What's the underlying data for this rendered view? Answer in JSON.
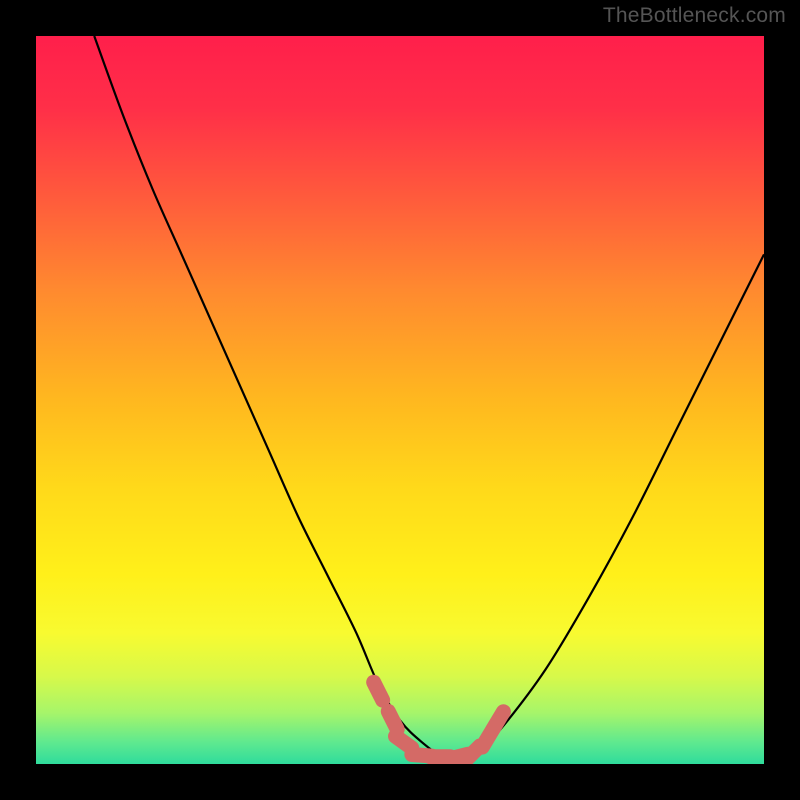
{
  "watermark": "TheBottleneck.com",
  "colors": {
    "bg": "#000000",
    "gradient_stops": [
      {
        "offset": 0.0,
        "color": "#ff1f4b"
      },
      {
        "offset": 0.1,
        "color": "#ff2f48"
      },
      {
        "offset": 0.22,
        "color": "#ff5a3c"
      },
      {
        "offset": 0.35,
        "color": "#ff8a2f"
      },
      {
        "offset": 0.5,
        "color": "#ffb81f"
      },
      {
        "offset": 0.62,
        "color": "#ffd91a"
      },
      {
        "offset": 0.74,
        "color": "#fff01a"
      },
      {
        "offset": 0.82,
        "color": "#f8fa30"
      },
      {
        "offset": 0.88,
        "color": "#d7f94a"
      },
      {
        "offset": 0.93,
        "color": "#a6f56a"
      },
      {
        "offset": 0.97,
        "color": "#5fe98f"
      },
      {
        "offset": 1.0,
        "color": "#2fdc9c"
      }
    ],
    "curve": "#000000",
    "marker_fill": "#d46a66",
    "marker_stroke": "#c45a58"
  },
  "chart_data": {
    "type": "line",
    "title": "",
    "xlabel": "",
    "ylabel": "",
    "xlim": [
      0,
      100
    ],
    "ylim": [
      0,
      100
    ],
    "series": [
      {
        "name": "curve",
        "x": [
          8,
          12,
          16,
          20,
          24,
          28,
          32,
          36,
          40,
          44,
          47,
          50,
          53,
          56,
          59,
          61,
          64,
          70,
          76,
          82,
          88,
          94,
          100
        ],
        "y": [
          100,
          89,
          79,
          70,
          61,
          52,
          43,
          34,
          26,
          18,
          11,
          6,
          3,
          1,
          1,
          2,
          5,
          13,
          23,
          34,
          46,
          58,
          70
        ]
      }
    ],
    "markers": [
      {
        "x": 47.0,
        "y": 10.0
      },
      {
        "x": 49.0,
        "y": 6.0
      },
      {
        "x": 50.5,
        "y": 3.0
      },
      {
        "x": 53.0,
        "y": 1.2
      },
      {
        "x": 55.5,
        "y": 1.0
      },
      {
        "x": 58.0,
        "y": 1.0
      },
      {
        "x": 60.0,
        "y": 1.5
      },
      {
        "x": 62.0,
        "y": 3.5
      },
      {
        "x": 63.5,
        "y": 6.0
      }
    ]
  }
}
